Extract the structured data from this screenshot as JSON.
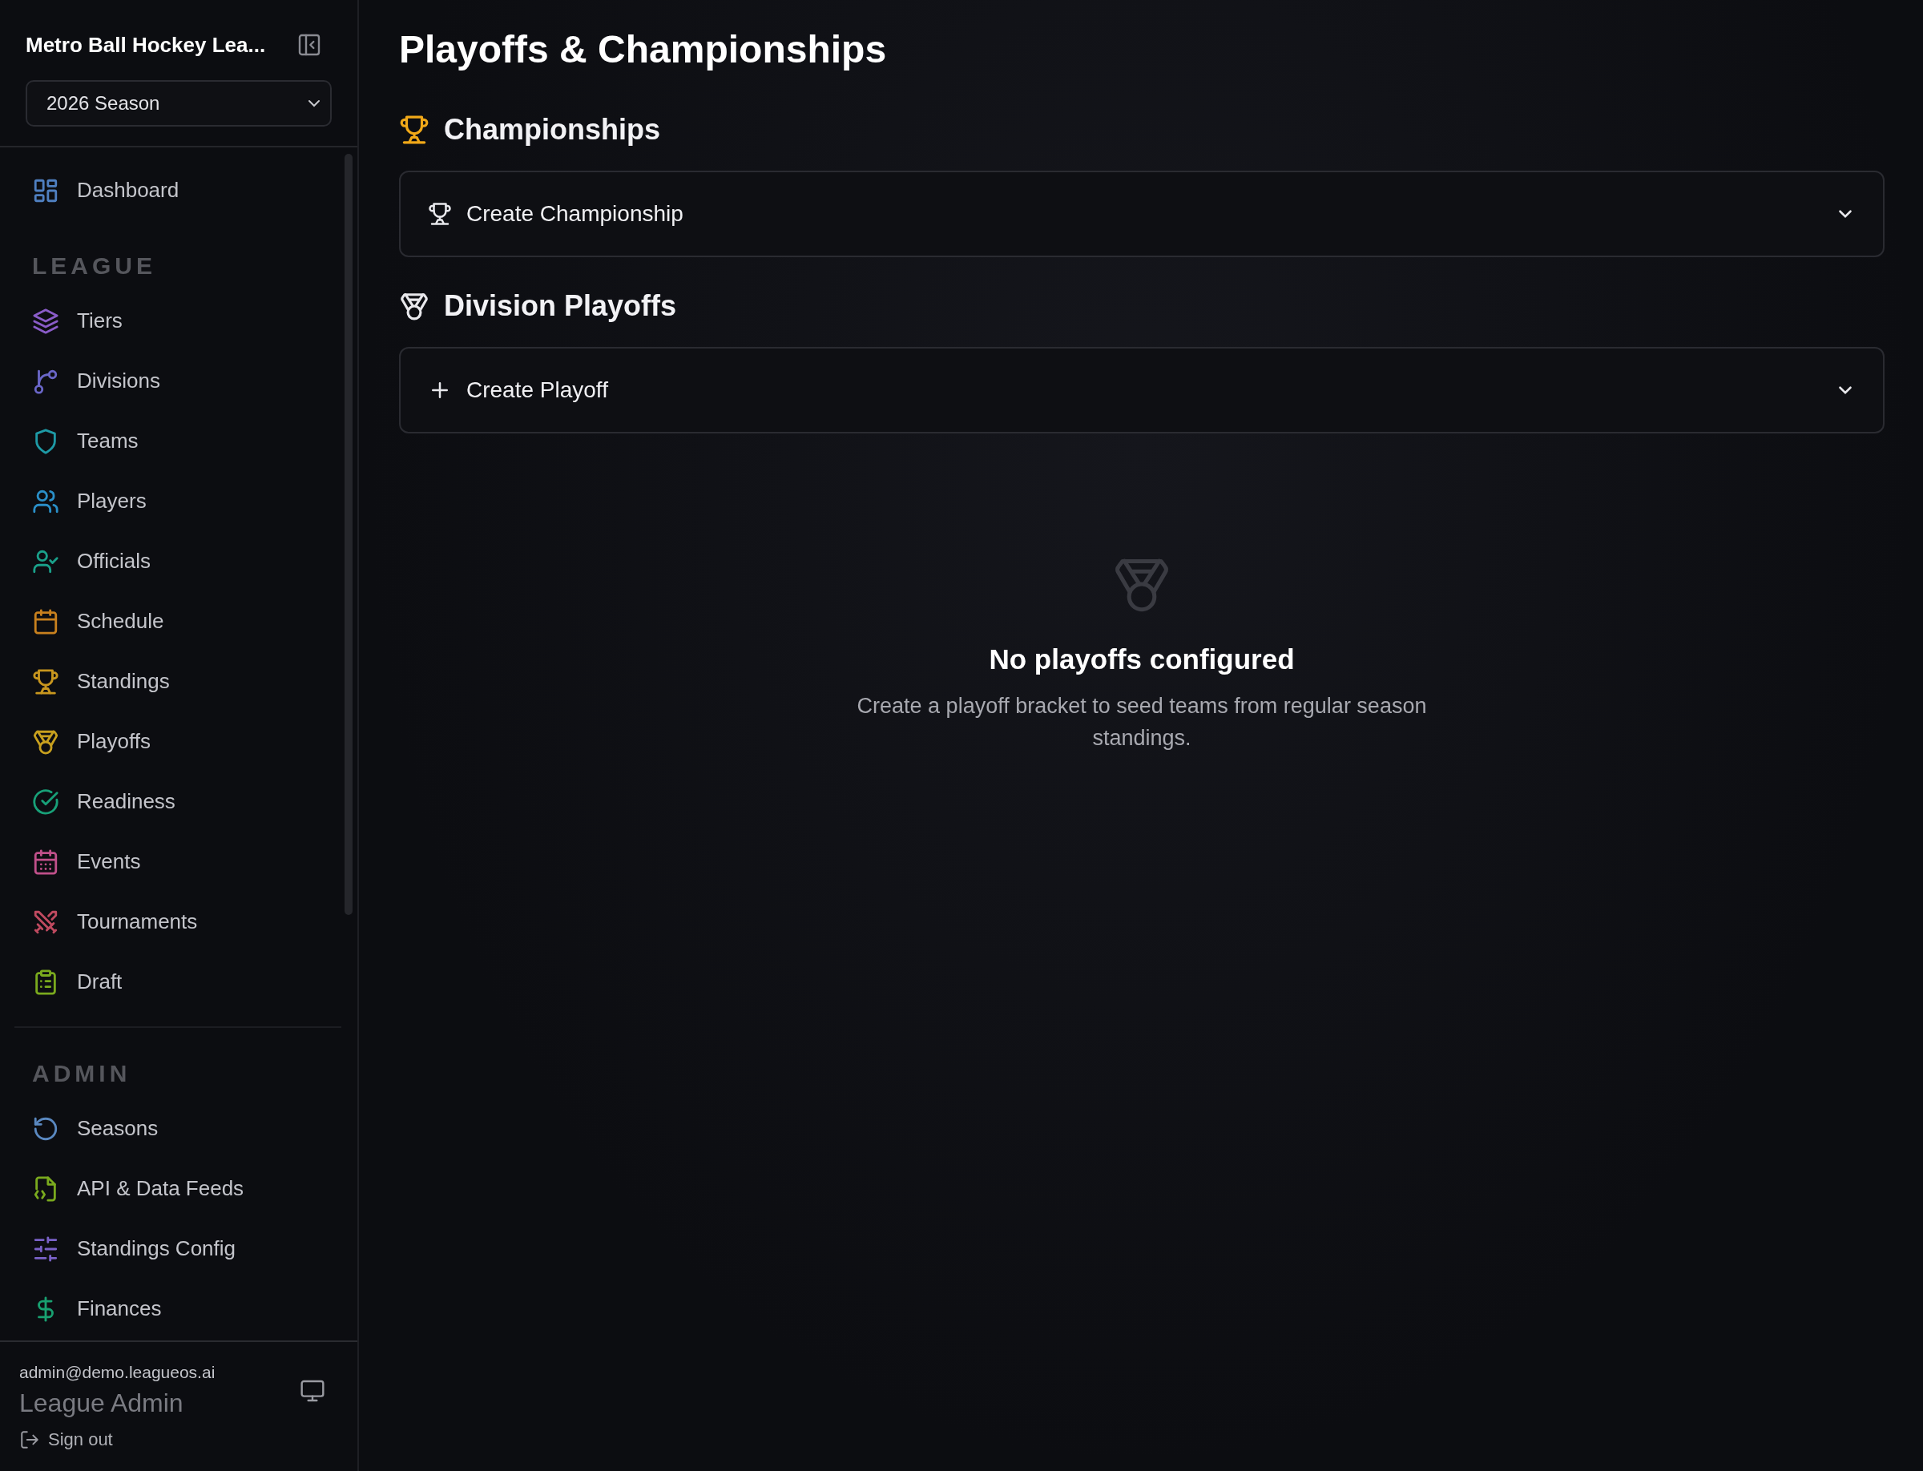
{
  "sidebar": {
    "league_name": "Metro Ball Hockey Lea...",
    "season_select": {
      "value": "2026 Season"
    },
    "top_items": [
      {
        "label": "Dashboard",
        "color": "#4f7fc0",
        "selected": false
      }
    ],
    "sections": [
      {
        "heading": "LEAGUE",
        "items": [
          {
            "label": "Tiers",
            "color": "#8a5cc8",
            "selected": false
          },
          {
            "label": "Divisions",
            "color": "#6a66c8",
            "selected": false
          },
          {
            "label": "Teams",
            "color": "#1e9aa6",
            "selected": false
          },
          {
            "label": "Players",
            "color": "#2a8fc8",
            "selected": false
          },
          {
            "label": "Officials",
            "color": "#1aa08a",
            "selected": false
          },
          {
            "label": "Schedule",
            "color": "#c8801e",
            "selected": false
          },
          {
            "label": "Standings",
            "color": "#c8961e",
            "selected": false
          },
          {
            "label": "Playoffs",
            "color": "#c8a01e",
            "selected": false
          },
          {
            "label": "Readiness",
            "color": "#18a078",
            "selected": false
          },
          {
            "label": "Events",
            "color": "#c0508a",
            "selected": false
          },
          {
            "label": "Tournaments",
            "color": "#c04a60",
            "selected": false
          },
          {
            "label": "Draft",
            "color": "#7aaa1e",
            "selected": false
          }
        ]
      },
      {
        "heading": "ADMIN",
        "items": [
          {
            "label": "Seasons",
            "color": "#5a88c0",
            "selected": false
          },
          {
            "label": "API & Data Feeds",
            "color": "#7aaa1e",
            "selected": false
          },
          {
            "label": "Standings Config",
            "color": "#7a62c8",
            "selected": false
          },
          {
            "label": "Finances",
            "color": "#18a070",
            "selected": false
          }
        ]
      }
    ],
    "user": {
      "email": "admin@demo.leagueos.ai",
      "role": "League Admin",
      "sign_out": "Sign out"
    }
  },
  "page": {
    "title": "Playoffs & Championships",
    "sections": [
      {
        "kind": "trophy",
        "heading": "Championships",
        "panel": {
          "kind": "trophy",
          "label": "Create Championship"
        }
      },
      {
        "kind": "medal",
        "heading": "Division Playoffs",
        "panel": {
          "kind": "plus",
          "label": "Create Playoff"
        }
      }
    ],
    "empty_state": {
      "title": "No playoffs configured",
      "message": "Create a playoff bracket to seed teams from regular season standings."
    }
  }
}
